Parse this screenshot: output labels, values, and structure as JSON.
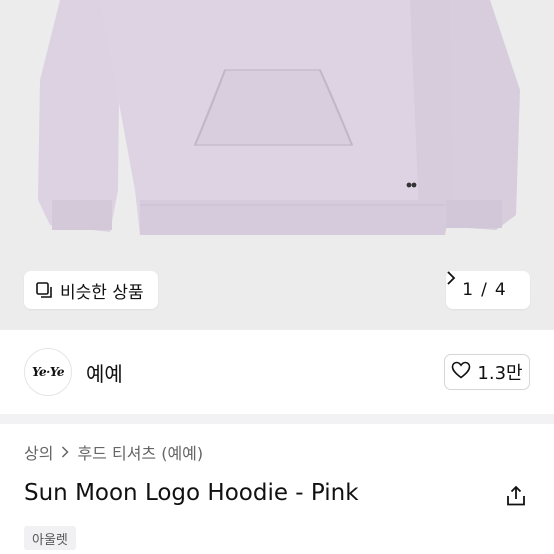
{
  "gallery": {
    "similar_label": "비슷한 상품",
    "counter_current": "1",
    "counter_separator": "/",
    "counter_total": "4",
    "colors": {
      "background": "#ececec",
      "garment": "#d9cfdf"
    }
  },
  "shop": {
    "avatar_text": "Ye·Ye",
    "name": "예예",
    "likes_label": "1.3만"
  },
  "breadcrumb": {
    "level1": "상의",
    "level2": "후드 티셔츠 (예예)"
  },
  "product": {
    "title": "Sun Moon Logo Hoodie - Pink",
    "badge": "아울렛"
  }
}
